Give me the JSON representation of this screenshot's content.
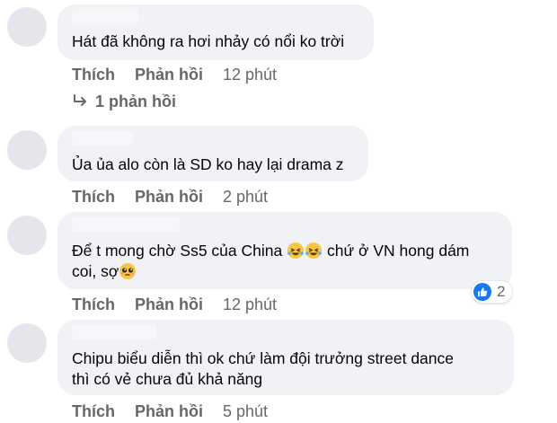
{
  "comments": [
    {
      "text": "Hát đã không ra hơi nhảy có nổi ko trời",
      "like_label": "Thích",
      "reply_label": "Phản hồi",
      "time": "12 phút",
      "replies_label": "1 phản hồi"
    },
    {
      "text": "Ủa ủa alo còn là SD ko hay lại drama z",
      "like_label": "Thích",
      "reply_label": "Phản hồi",
      "time": "2 phút"
    },
    {
      "text_line1_pre": "Để t mong chờ Ss5 của China ",
      "text_line1_post": " chứ ở VN hong dám",
      "text_line2": "coi, sợ",
      "emojis": [
        "laughing-tears-emoji",
        "laughing-tears-emoji",
        "pleading-face-emoji"
      ],
      "reaction_count": "2",
      "reaction_icon": "like-reaction-icon",
      "like_label": "Thích",
      "reply_label": "Phản hồi",
      "time": "12 phút"
    },
    {
      "text": "Chipu biểu diễn thì ok chứ làm đội trưởng street dance\nthì có vẻ chưa đủ khả năng",
      "like_label": "Thích",
      "reply_label": "Phản hồi",
      "time": "5 phút"
    }
  ],
  "colors": {
    "bubble": "#f0f2f5",
    "action_text": "#65676b",
    "like_blue": "#1877f2"
  }
}
